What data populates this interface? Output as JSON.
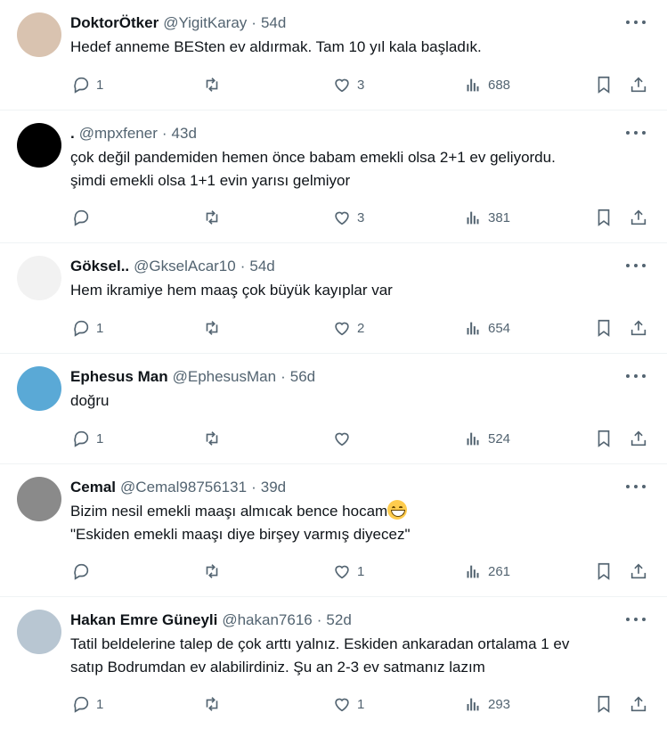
{
  "tweets": [
    {
      "name": "DoktorÖtker",
      "handle": "@YigitKaray",
      "time": "54d",
      "lines": [
        "Hedef anneme BESten ev aldırmak. Tam 10 yıl kala başladık."
      ],
      "replies": "1",
      "retweets": "",
      "likes": "3",
      "views": "688",
      "avatar_color": "#d9c3b0"
    },
    {
      "name": ".",
      "handle": "@mpxfener",
      "time": "43d",
      "lines": [
        "çok değil pandemiden hemen önce babam emekli olsa 2+1 ev geliyordu.",
        "şimdi emekli olsa 1+1 evin yarısı gelmiyor"
      ],
      "replies": "",
      "retweets": "",
      "likes": "3",
      "views": "381",
      "avatar_color": "#000000"
    },
    {
      "name": "Göksel..",
      "handle": "@GkselAcar10",
      "time": "54d",
      "lines": [
        "Hem ikramiye hem maaş çok büyük kayıplar var"
      ],
      "replies": "1",
      "retweets": "",
      "likes": "2",
      "views": "654",
      "avatar_color": "#f2f2f2"
    },
    {
      "name": "Ephesus Man",
      "handle": "@EphesusMan",
      "time": "56d",
      "lines": [
        "doğru"
      ],
      "replies": "1",
      "retweets": "",
      "likes": "",
      "views": "524",
      "avatar_color": "#5aa9d6"
    },
    {
      "name": "Cemal",
      "handle": "@Cemal98756131",
      "time": "39d",
      "lines": [
        "Bizim nesil emekli maaşı almıcak bence hocam",
        "\"Eskiden emekli maaşı diye birşey varmış diyecez\""
      ],
      "replies": "",
      "retweets": "",
      "likes": "1",
      "views": "261",
      "avatar_color": "#8a8a8a"
    },
    {
      "name": "Hakan Emre Güneyli",
      "handle": "@hakan7616",
      "time": "52d",
      "lines": [
        "Tatil beldelerine talep de çok arttı yalnız. Eskiden ankaradan ortalama 1 ev",
        "satıp Bodrumdan ev alabilirdiniz. Şu an 2-3 ev satmanız lazım"
      ],
      "replies": "1",
      "retweets": "",
      "likes": "1",
      "views": "293",
      "avatar_color": "#b8c6d2"
    }
  ],
  "separator": "·",
  "icons": {
    "reply": "reply-icon",
    "retweet": "retweet-icon",
    "like": "heart-icon",
    "views": "views-icon",
    "bookmark": "bookmark-icon",
    "share": "share-icon",
    "more": "more-icon",
    "emoji": "grinning-face-icon"
  }
}
